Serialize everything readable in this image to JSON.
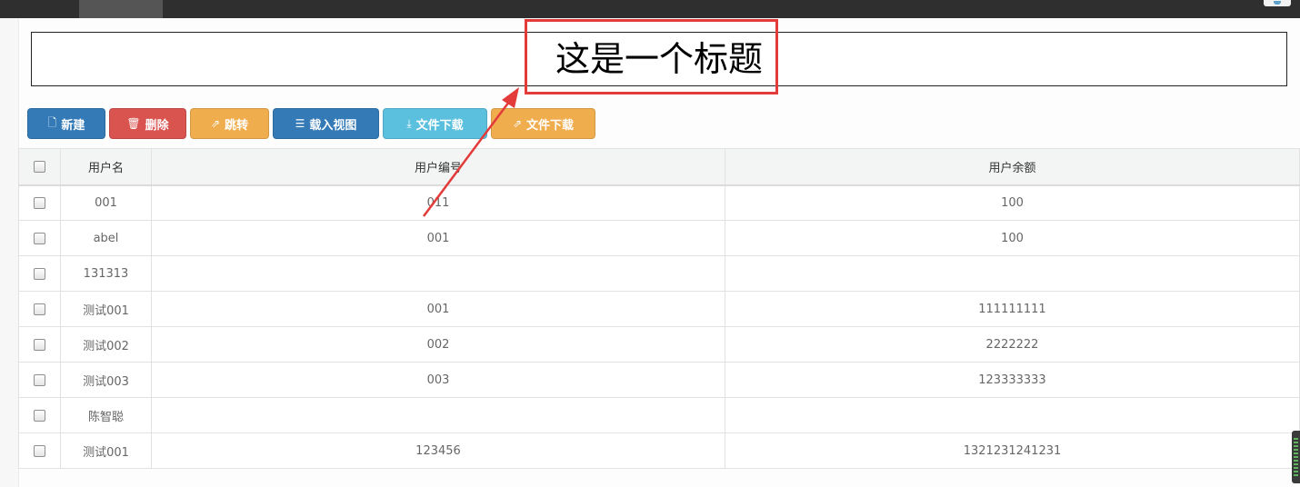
{
  "header": {
    "title": "这是一个标题"
  },
  "toolbar": {
    "buttons": [
      {
        "label": "新建",
        "icon": "file-icon"
      },
      {
        "label": "删除",
        "icon": "trash-icon"
      },
      {
        "label": "跳转",
        "icon": "share-icon"
      },
      {
        "label": "载入视图",
        "icon": "list-icon"
      },
      {
        "label": "文件下载",
        "icon": "download-icon"
      },
      {
        "label": "文件下载",
        "icon": "share-icon"
      }
    ]
  },
  "table": {
    "columns": [
      "用户名",
      "用户编号",
      "用户余额"
    ],
    "rows": [
      {
        "username": "001",
        "user_id": "011",
        "balance": "100"
      },
      {
        "username": "abel",
        "user_id": "001",
        "balance": "100"
      },
      {
        "username": "131313",
        "user_id": "",
        "balance": ""
      },
      {
        "username": "测试001",
        "user_id": "001",
        "balance": "111111111"
      },
      {
        "username": "测试002",
        "user_id": "002",
        "balance": "2222222"
      },
      {
        "username": "测试003",
        "user_id": "003",
        "balance": "123333333"
      },
      {
        "username": "陈智聪",
        "user_id": "",
        "balance": ""
      },
      {
        "username": "测试001",
        "user_id": "123456",
        "balance": "1321231241231"
      }
    ]
  },
  "colors": {
    "primary": "#337ab7",
    "danger": "#d9534f",
    "warning": "#f0ad4e",
    "info": "#5bc0de",
    "annotation": "#e33a3a"
  }
}
